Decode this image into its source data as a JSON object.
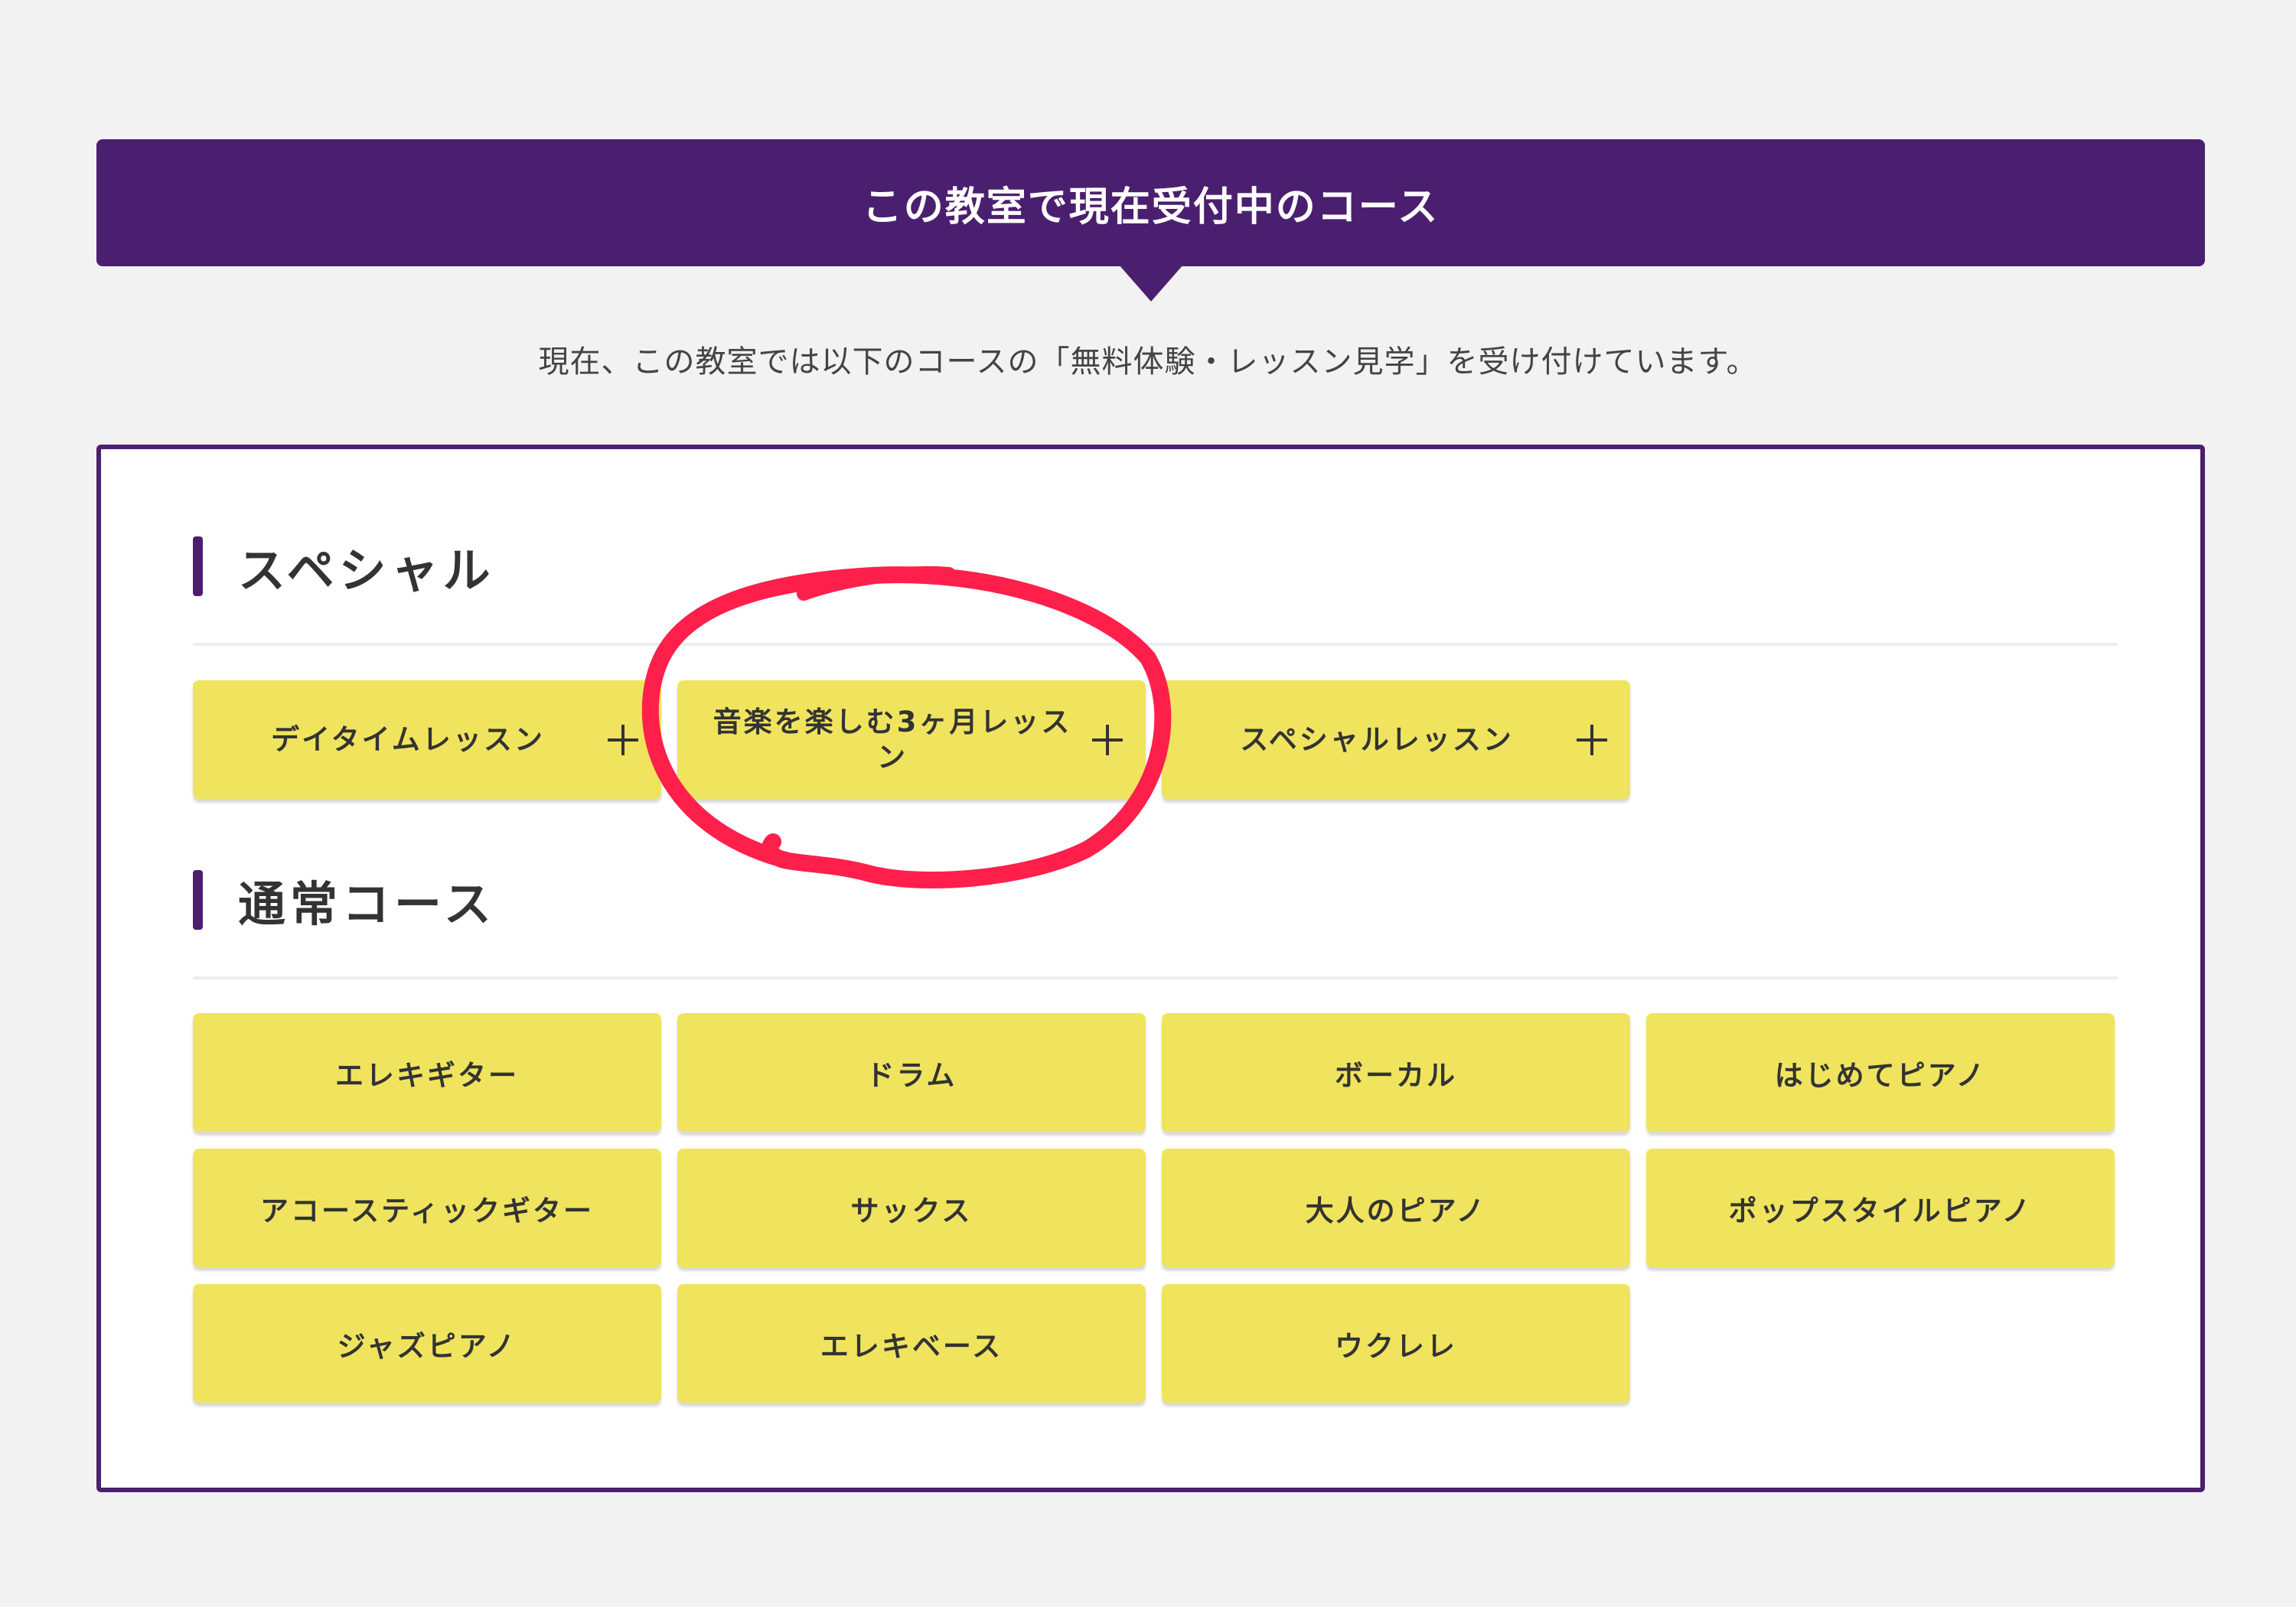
{
  "header": {
    "title": "この教室で現在受付中のコース"
  },
  "intro": {
    "text": "現在、この教室では以下のコースの「無料体験・レッスン見学」を受け付けています。"
  },
  "sections": [
    {
      "title": "スペシャル",
      "items": [
        {
          "label": "デイタイムレッスン",
          "expandable": true
        },
        {
          "label": "音楽を楽しむ3ヶ月レッスン",
          "expandable": true
        },
        {
          "label": "スペシャルレッスン",
          "expandable": true
        }
      ]
    },
    {
      "title": "通常コース",
      "items": [
        {
          "label": "エレキギター"
        },
        {
          "label": "ドラム"
        },
        {
          "label": "ボーカル"
        },
        {
          "label": "はじめてピアノ"
        },
        {
          "label": "アコースティックギター"
        },
        {
          "label": "サックス"
        },
        {
          "label": "大人のピアノ"
        },
        {
          "label": "ポップスタイルピアノ"
        },
        {
          "label": "ジャズピアノ"
        },
        {
          "label": "エレキベース"
        },
        {
          "label": "ウクレレ"
        }
      ]
    }
  ],
  "colors": {
    "primary": "#4b1f6f",
    "button": "#f0e45e",
    "background": "#f2f2f2",
    "annotation": "#ff1f4b"
  },
  "icons": {
    "expand": "plus-icon"
  }
}
